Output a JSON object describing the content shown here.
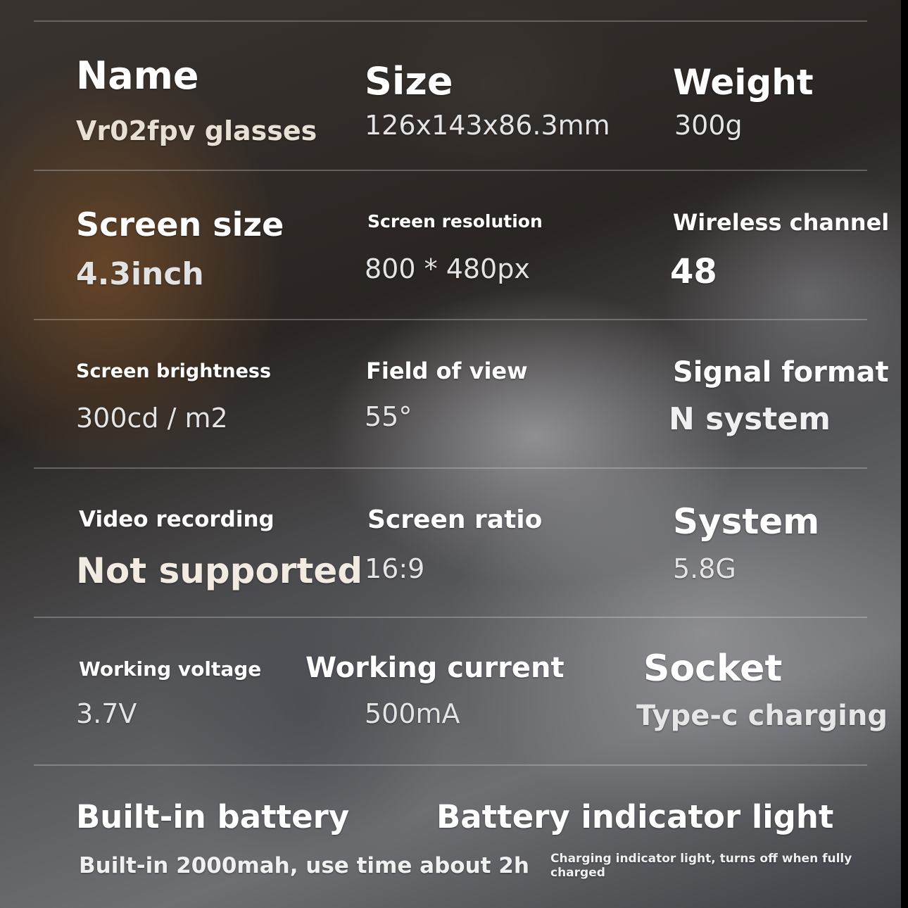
{
  "specs": {
    "name": {
      "label": "Name",
      "value": "Vr02fpv glasses"
    },
    "size": {
      "label": "Size",
      "value": "126x143x86.3mm"
    },
    "weight": {
      "label": "Weight",
      "value": "300g"
    },
    "screen_size": {
      "label": "Screen size",
      "value": "4.3inch"
    },
    "screen_resolution": {
      "label": "Screen resolution",
      "value": "800 * 480px"
    },
    "wireless_channel": {
      "label": "Wireless channel",
      "value": "48"
    },
    "screen_brightness": {
      "label": "Screen brightness",
      "value": "300cd / m2"
    },
    "field_of_view": {
      "label": "Field of view",
      "value": "55°"
    },
    "signal_format": {
      "label": "Signal format",
      "value": "N system"
    },
    "video_recording": {
      "label": "Video recording",
      "value": "Not supported"
    },
    "screen_ratio": {
      "label": "Screen ratio",
      "value": "16:9"
    },
    "system": {
      "label": "System",
      "value": "5.8G"
    },
    "working_voltage": {
      "label": "Working voltage",
      "value": "3.7V"
    },
    "working_current": {
      "label": "Working current",
      "value": "500mA"
    },
    "socket": {
      "label": "Socket",
      "value": "Type-c charging"
    },
    "built_in_battery": {
      "label": "Built-in battery",
      "value": "Built-in 2000mah, use time about 2h"
    },
    "battery_indicator_light": {
      "label": "Battery indicator light",
      "value": "Charging indicator light, turns off when fully charged"
    }
  }
}
